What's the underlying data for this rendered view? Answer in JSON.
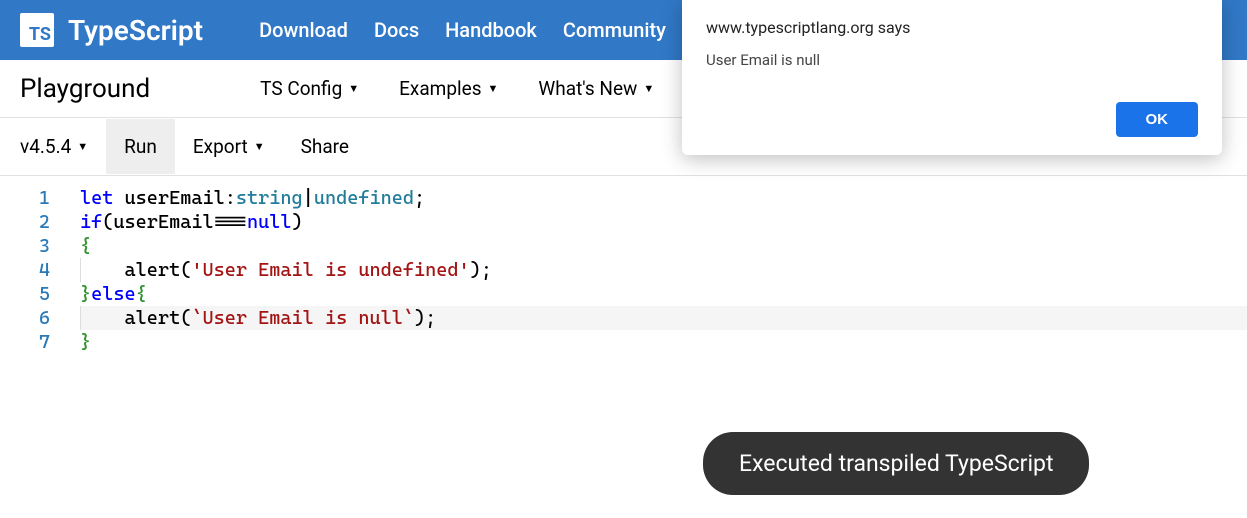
{
  "navbar": {
    "logo_abbrev": "TS",
    "logo_text": "TypeScript",
    "links": [
      "Download",
      "Docs",
      "Handbook",
      "Community"
    ]
  },
  "subheader": {
    "title": "Playground",
    "items": [
      "TS Config",
      "Examples",
      "What's New"
    ]
  },
  "toolbar": {
    "version": "v4.5.4",
    "run": "Run",
    "export": "Export",
    "share": "Share"
  },
  "editor": {
    "line_numbers": [
      "1",
      "2",
      "3",
      "4",
      "5",
      "6",
      "7"
    ],
    "lines": [
      {
        "tokens": [
          {
            "t": "let ",
            "c": "keyword"
          },
          {
            "t": "userEmail",
            "c": "ident"
          },
          {
            "t": ":",
            "c": "op"
          },
          {
            "t": "string",
            "c": "type"
          },
          {
            "t": "|",
            "c": "op"
          },
          {
            "t": "undefined",
            "c": "type"
          },
          {
            "t": ";",
            "c": "op"
          }
        ]
      },
      {
        "tokens": [
          {
            "t": "if",
            "c": "keyword"
          },
          {
            "t": "(",
            "c": "op"
          },
          {
            "t": "userEmail",
            "c": "ident"
          },
          {
            "t": "===",
            "c": "op"
          },
          {
            "t": "null",
            "c": "null"
          },
          {
            "t": ")",
            "c": "op"
          }
        ]
      },
      {
        "tokens": [
          {
            "t": "{",
            "c": "brace"
          }
        ]
      },
      {
        "indent": true,
        "tokens": [
          {
            "t": "    ",
            "c": "none"
          },
          {
            "t": "alert",
            "c": "func"
          },
          {
            "t": "(",
            "c": "op"
          },
          {
            "t": "'User Email is undefined'",
            "c": "string"
          },
          {
            "t": ")",
            "c": "op"
          },
          {
            "t": ";",
            "c": "op"
          }
        ]
      },
      {
        "tokens": [
          {
            "t": "}",
            "c": "brace"
          },
          {
            "t": "else",
            "c": "keyword"
          },
          {
            "t": "{",
            "c": "brace"
          }
        ]
      },
      {
        "indent": true,
        "current": true,
        "tokens": [
          {
            "t": "    ",
            "c": "none"
          },
          {
            "t": "alert",
            "c": "func"
          },
          {
            "t": "(",
            "c": "op"
          },
          {
            "t": "`User Email is null`",
            "c": "string"
          },
          {
            "t": ")",
            "c": "op"
          },
          {
            "t": ";",
            "c": "op"
          }
        ]
      },
      {
        "tokens": [
          {
            "t": "}",
            "c": "brace"
          }
        ]
      }
    ]
  },
  "alert": {
    "origin": "www.typescriptlang.org says",
    "message": "User Email is null",
    "ok": "OK"
  },
  "toast": {
    "message": "Executed transpiled TypeScript"
  }
}
